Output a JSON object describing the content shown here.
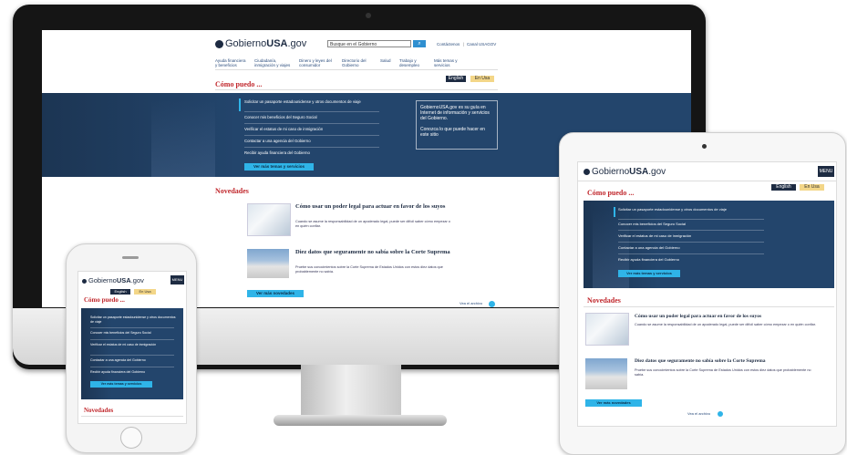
{
  "site": {
    "logo_prefix": "Gobierno",
    "logo_bold": "USA",
    "logo_suffix": ".gov",
    "search_placeholder": "Busque en el Gobierno",
    "top_links": [
      "Contáctenos",
      "Canal USAGOV"
    ],
    "nav": [
      "Ayuda financiera y beneficios",
      "Ciudadanía, inmigración y viajes",
      "Dinero y leyes del consumidor",
      "Directorio del Gobierno",
      "Salud",
      "Trabajo y desempleo",
      "Más temas y servicios"
    ],
    "lang_en": "English",
    "lang_es": "En Usa",
    "menu": "MENU"
  },
  "como_puedo": {
    "title": "Cómo puedo ...",
    "links": [
      "Solicitar un pasaporte estadounidense y otros documentos de viaje",
      "Conocer mis beneficios del Seguro Social",
      "Verificar el estatus de mi caso de inmigración",
      "Contactar a una agencia del Gobierno",
      "Recibir ayuda financiera del Gobierno"
    ],
    "more_button": "Ver más temas y servicios",
    "callout_text": "GobiernoUSA.gov es su guía en Internet de información y servicios del Gobierno.",
    "callout_link": "Conozca lo que puede hacer en este sitio"
  },
  "novedades": {
    "title": "Novedades",
    "articles": [
      {
        "title": "Cómo usar un poder legal para actuar en favor de los suyos",
        "desc": "Cuando se asume la responsabilidad de un apoderado legal, puede ser difícil saber cómo empezar o en quién confiar."
      },
      {
        "title": "Diez datos que seguramente no sabía sobre la Corte Suprema",
        "desc": "Pruebe sus conocimientos sobre la Corte Suprema de Estados Unidos con estos diez datos que probablemente no sabía."
      }
    ],
    "more_button": "Ver más novedades",
    "archive": "Vea el archivo"
  }
}
